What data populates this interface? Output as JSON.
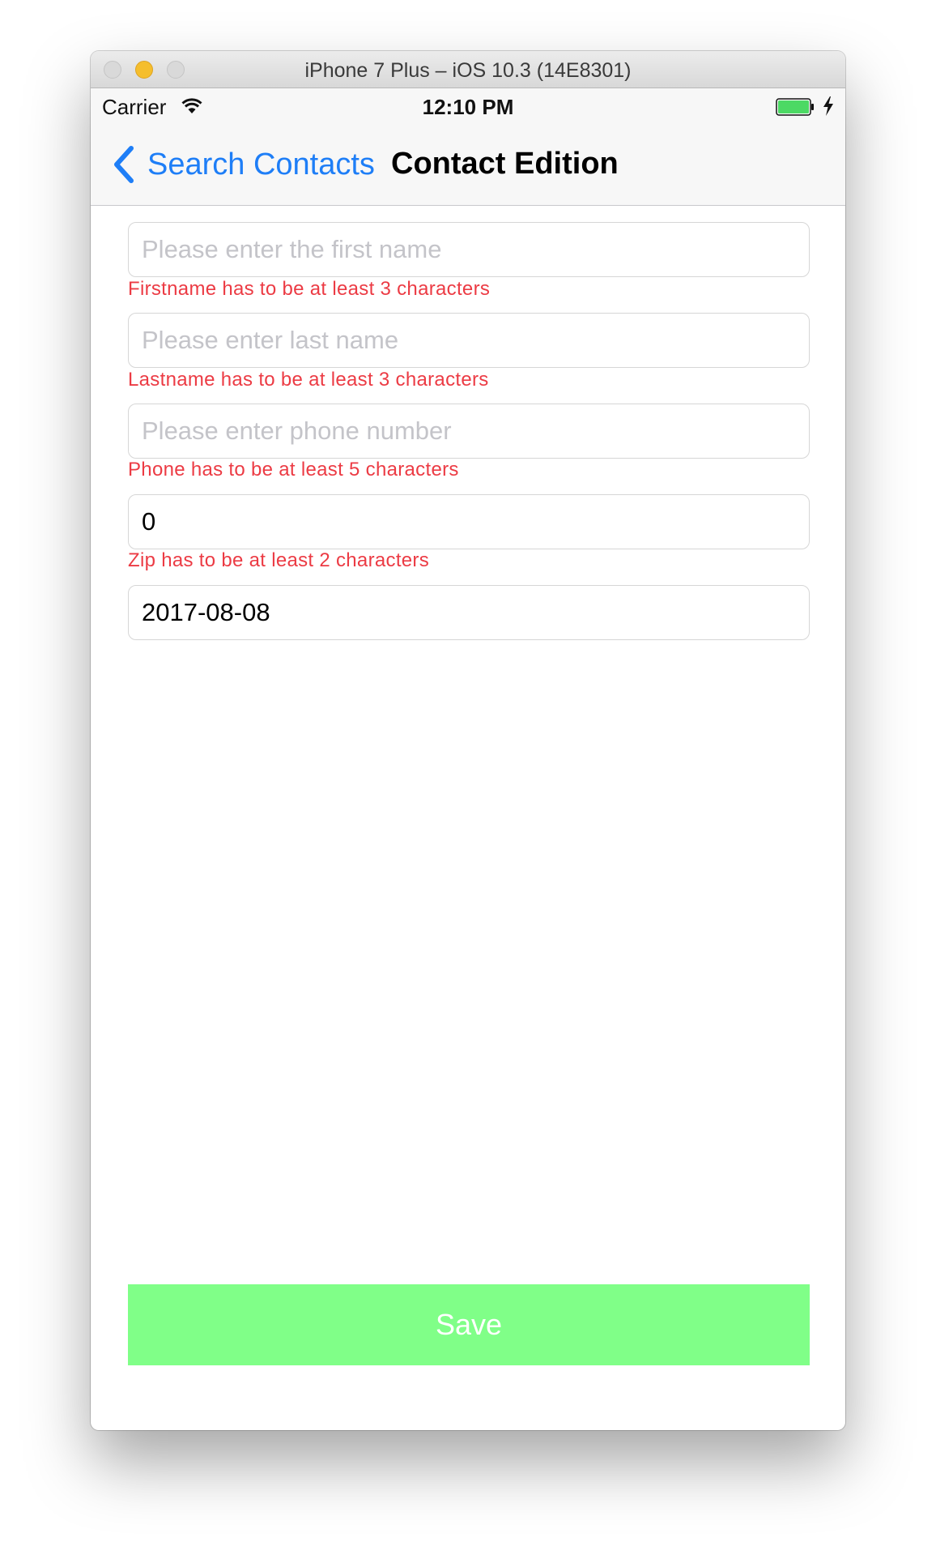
{
  "window": {
    "title": "iPhone 7 Plus – iOS 10.3 (14E8301)"
  },
  "status_bar": {
    "carrier": "Carrier",
    "time": "12:10 PM"
  },
  "nav": {
    "back_label": "Search Contacts",
    "title": "Contact Edition"
  },
  "form": {
    "first_name": {
      "value": "",
      "placeholder": "Please enter the first name",
      "error": "Firstname has to be at least 3 characters"
    },
    "last_name": {
      "value": "",
      "placeholder": "Please enter last name",
      "error": "Lastname has to be at least 3 characters"
    },
    "phone": {
      "value": "",
      "placeholder": "Please enter phone number",
      "error": "Phone has to be at least 5 characters"
    },
    "zip": {
      "value": "0",
      "error": "Zip has to be at least 2 characters"
    },
    "date": {
      "value": "2017-08-08"
    }
  },
  "save_label": "Save",
  "colors": {
    "accent": "#1e7ef7",
    "error": "#ec3b44",
    "save_bg": "#80ff88",
    "battery": "#4cd964"
  }
}
